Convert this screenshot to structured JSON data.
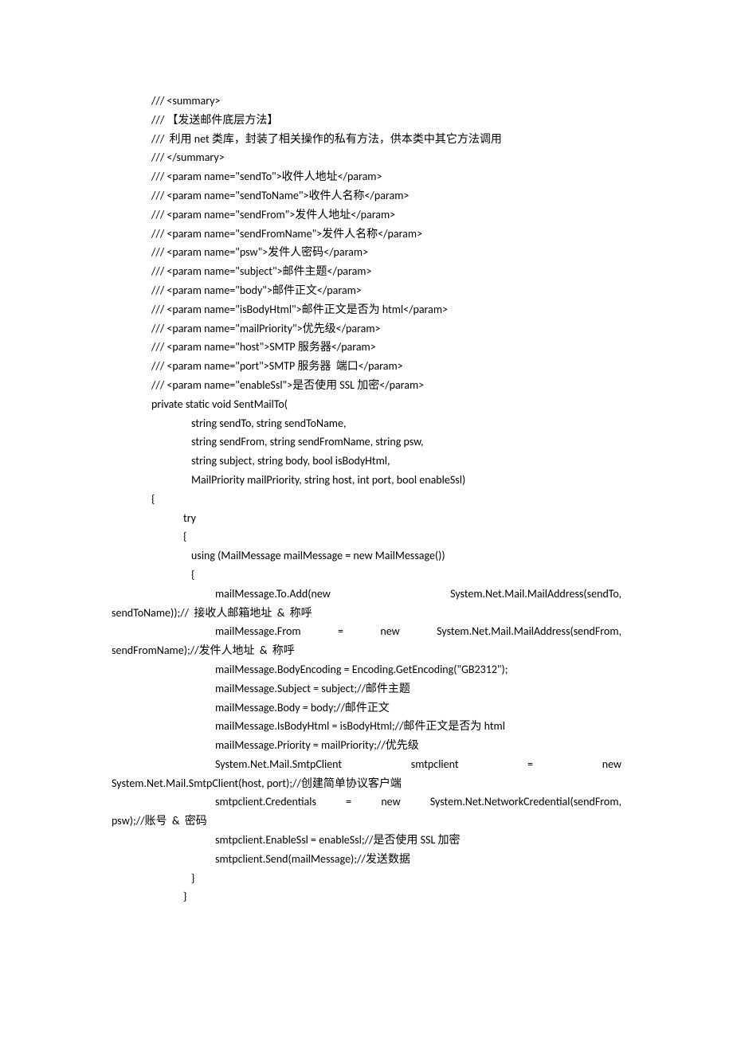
{
  "lines": [
    {
      "cls": "ind1",
      "text": "/// <summary>"
    },
    {
      "cls": "ind1",
      "text": "/// 【发送邮件底层方法】"
    },
    {
      "cls": "ind1",
      "text": "///  利用 net 类库，封装了相关操作的私有方法，供本类中其它方法调用"
    },
    {
      "cls": "ind1",
      "text": "/// </summary>"
    },
    {
      "cls": "ind1",
      "text": "/// <param name=\"sendTo\">收件人地址</param>"
    },
    {
      "cls": "ind1",
      "text": "/// <param name=\"sendToName\">收件人名称</param>"
    },
    {
      "cls": "ind1",
      "text": "/// <param name=\"sendFrom\">发件人地址</param>"
    },
    {
      "cls": "ind1",
      "text": "/// <param name=\"sendFromName\">发件人名称</param>"
    },
    {
      "cls": "ind1",
      "text": "/// <param name=\"psw\">发件人密码</param>"
    },
    {
      "cls": "ind1",
      "text": "/// <param name=\"subject\">邮件主题</param>"
    },
    {
      "cls": "ind1",
      "text": "/// <param name=\"body\">邮件正文</param>"
    },
    {
      "cls": "ind1",
      "text": "/// <param name=\"isBodyHtml\">邮件正文是否为 html</param>"
    },
    {
      "cls": "ind1",
      "text": "/// <param name=\"mailPriority\">优先级</param>"
    },
    {
      "cls": "ind1",
      "text": "/// <param name=\"host\">SMTP 服务器</param>"
    },
    {
      "cls": "ind1",
      "text": "/// <param name=\"port\">SMTP 服务器  端口</param>"
    },
    {
      "cls": "ind1",
      "text": "/// <param name=\"enableSsl\">是否使用 SSL 加密</param>"
    },
    {
      "cls": "ind1",
      "text": "private static void SentMailTo("
    },
    {
      "cls": "ind3",
      "text": "string sendTo, string sendToName,"
    },
    {
      "cls": "ind3",
      "text": "string sendFrom, string sendFromName, string psw,"
    },
    {
      "cls": "ind3",
      "text": "string subject, string body, bool isBodyHtml,"
    },
    {
      "cls": "ind3",
      "text": "MailPriority mailPriority, string host, int port, bool enableSsl)"
    },
    {
      "cls": "ind1",
      "text": "{"
    },
    {
      "cls": "ind2",
      "text": "try"
    },
    {
      "cls": "ind2",
      "text": "{"
    },
    {
      "cls": "ind3",
      "text": "using (MailMessage mailMessage = new MailMessage())"
    },
    {
      "cls": "ind3",
      "text": "{"
    },
    {
      "cls": "ind3",
      "text": ""
    },
    {
      "cls": "ind4 justify",
      "text": "mailMessage.To.Add(new              System.Net.Mail.MailAddress(sendTo,"
    },
    {
      "cls": "wrap",
      "text": "sendToName));//  接收人邮箱地址  &  称呼"
    },
    {
      "cls": "ind4 justify",
      "text": "mailMessage.From    =    new    System.Net.Mail.MailAddress(sendFrom,"
    },
    {
      "cls": "wrap",
      "text": "sendFromName);//发件人地址  &  称呼"
    },
    {
      "cls": "ind4",
      "text": "mailMessage.BodyEncoding = Encoding.GetEncoding(\"GB2312\");"
    },
    {
      "cls": "ind4",
      "text": "mailMessage.Subject = subject;//邮件主题"
    },
    {
      "cls": "ind4",
      "text": "mailMessage.Body = body;//邮件正文"
    },
    {
      "cls": "ind4",
      "text": "mailMessage.IsBodyHtml = isBodyHtml;//邮件正文是否为 html"
    },
    {
      "cls": "ind4",
      "text": "mailMessage.Priority = mailPriority;//优先级"
    },
    {
      "cls": "ind4 justify",
      "text": "System.Net.Mail.SmtpClient          smtpclient          =          new"
    },
    {
      "cls": "wrap",
      "text": "System.Net.Mail.SmtpClient(host, port);//创建简单协议客户端"
    },
    {
      "cls": "ind4 justify",
      "text": "smtpclient.Credentials   =   new   System.Net.NetworkCredential(sendFrom,"
    },
    {
      "cls": "wrap",
      "text": "psw);//账号  &  密码"
    },
    {
      "cls": "ind4",
      "text": "smtpclient.EnableSsl = enableSsl;//是否使用 SSL 加密"
    },
    {
      "cls": "ind4",
      "text": "smtpclient.Send(mailMessage);//发送数据"
    },
    {
      "cls": "ind3",
      "text": "}"
    },
    {
      "cls": "ind2",
      "text": "}"
    }
  ]
}
